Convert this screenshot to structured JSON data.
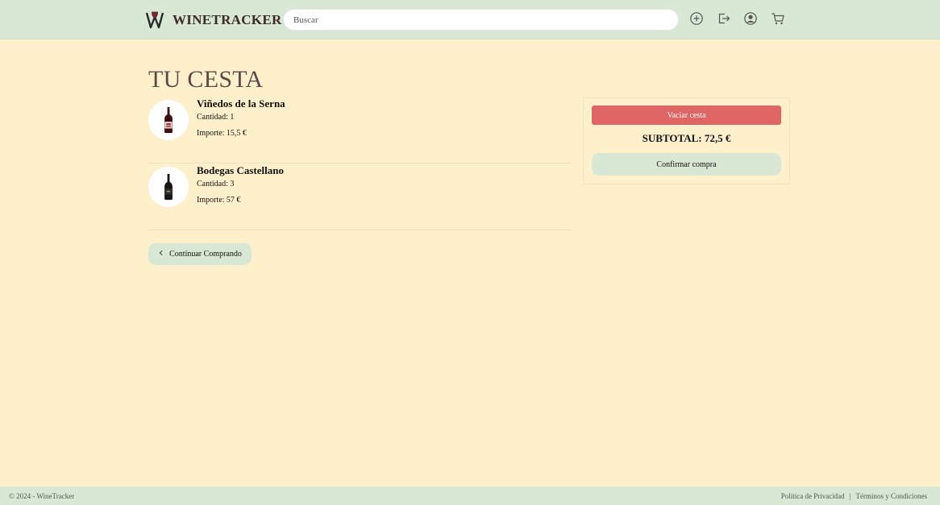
{
  "brand": {
    "name": "WINETRACKER",
    "logo_icon": "wine-glass-w-logo-icon"
  },
  "search": {
    "placeholder": "Buscar",
    "value": ""
  },
  "nav_icons": [
    "plus-circle-icon",
    "logout-icon",
    "user-icon",
    "cart-icon"
  ],
  "page": {
    "title": "TU CESTA"
  },
  "cart": {
    "items": [
      {
        "name": "Viñedos de la Serna",
        "quantity": "Cantidad: 1",
        "amount": "Importe: 15,5 €",
        "image_icon": "wine-bottle-icon"
      },
      {
        "name": "Bodegas Castellano",
        "quantity": "Cantidad: 3",
        "amount": "Importe: 57 €",
        "image_icon": "wine-bottle-icon"
      }
    ],
    "continue_label": "Continuar Comprando"
  },
  "summary": {
    "empty_label": "Vaciar cesta",
    "subtotal": "SUBTOTAL: 72,5 €",
    "confirm_label": "Confirmar compra"
  },
  "footer": {
    "copyright": "© 2024 - WineTracker",
    "privacy": "Política de Privacidad",
    "separator": "|",
    "terms": "Términos y Condiciones"
  },
  "colors": {
    "background": "#fff0cc",
    "navbar": "#d8e8d4",
    "danger": "#e06565",
    "title": "#5a4a47"
  }
}
